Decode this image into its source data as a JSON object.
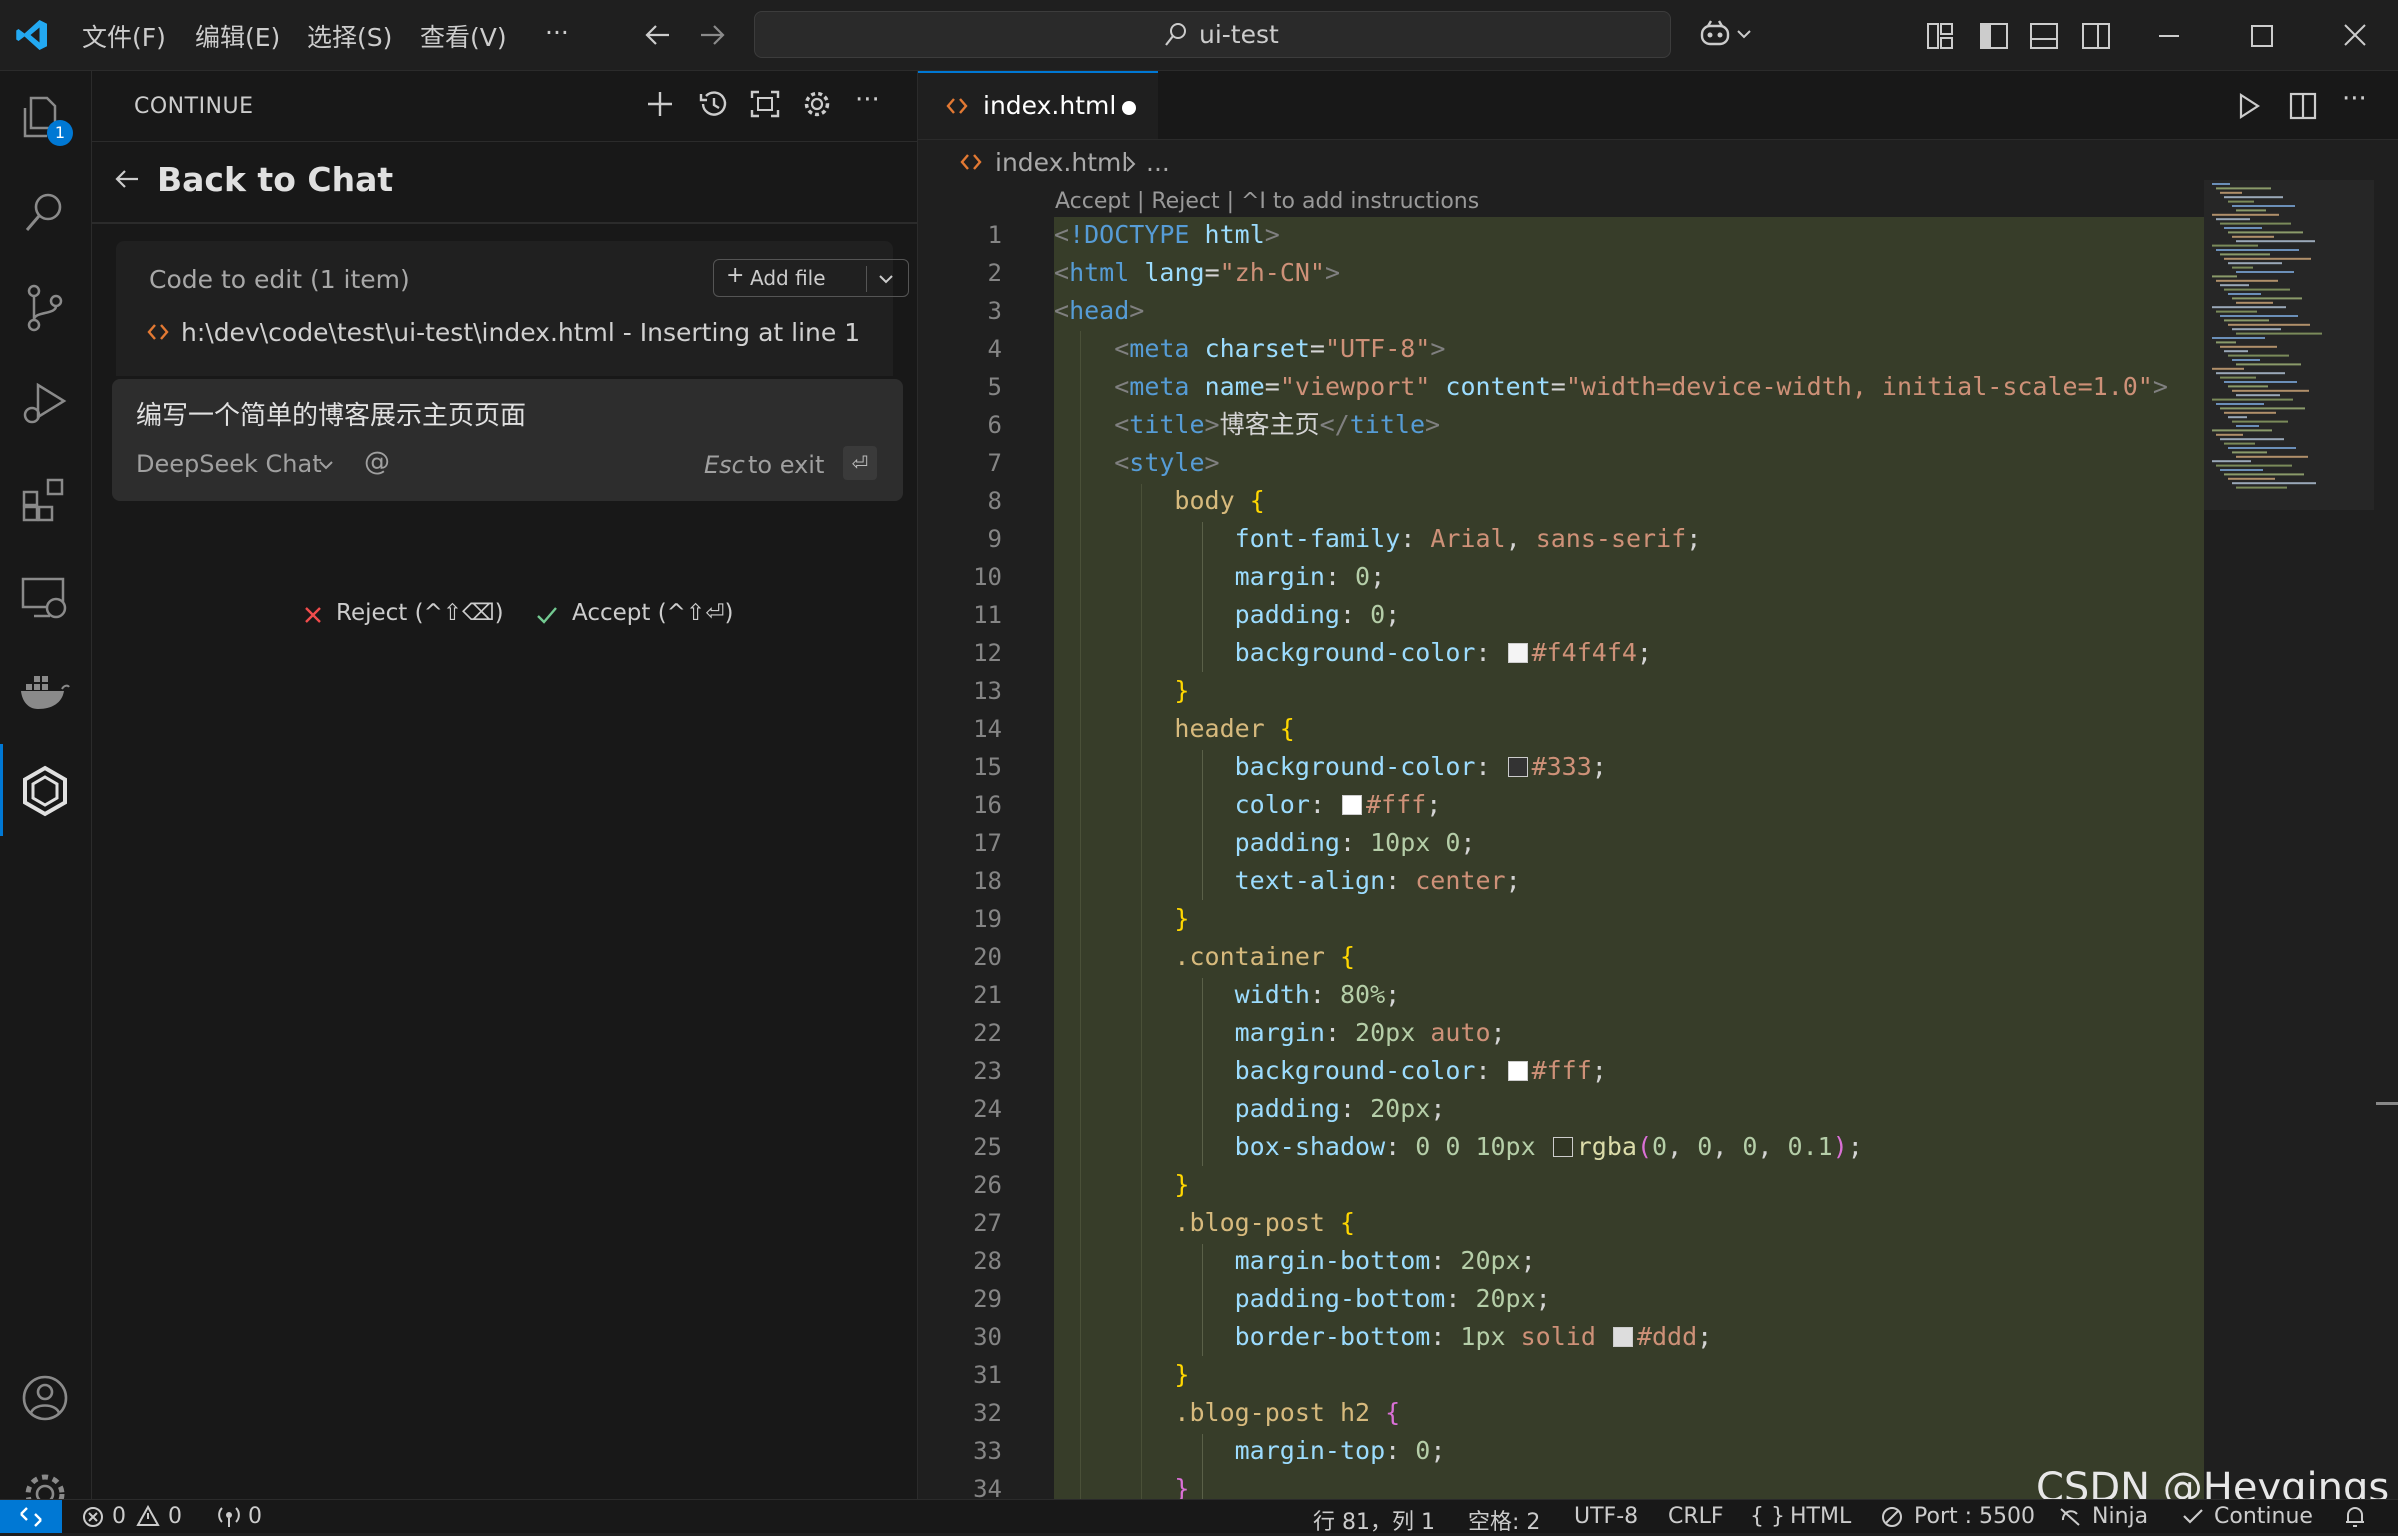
{
  "titlebar": {
    "menus": [
      "文件(F)",
      "编辑(E)",
      "选择(S)",
      "查看(V)",
      "···"
    ],
    "search_text": "ui-test"
  },
  "activity": {
    "explorer_badge": "1"
  },
  "panel": {
    "title": "CONTINUE",
    "back_label": "Back to Chat",
    "code_to_edit_label": "Code to edit (1 item)",
    "add_file_label": "Add file",
    "file_path": "h:\\dev\\code\\test\\ui-test\\index.html - Inserting at line 1",
    "prompt_text": "编写一个简单的博客展示主页页面",
    "model_label": "DeepSeek Chat",
    "at_symbol": "@",
    "esc_key": "Esc",
    "esc_text": "to exit",
    "reject_label": "Reject (^⇧⌫)",
    "accept_label": "Accept (^⇧⏎)"
  },
  "editor": {
    "tab_label": "index.html",
    "breadcrumb_file": "index.html",
    "breadcrumb_more": "...",
    "codelens": "Accept | Reject | ^I to add instructions",
    "line_numbers": [
      "1",
      "2",
      "3",
      "4",
      "5",
      "6",
      "7",
      "8",
      "9",
      "10",
      "11",
      "12",
      "13",
      "14",
      "15",
      "16",
      "17",
      "18",
      "19",
      "20",
      "21",
      "22",
      "23",
      "24",
      "25",
      "26",
      "27",
      "28",
      "29",
      "30",
      "31",
      "32",
      "33",
      "34"
    ]
  },
  "statusbar": {
    "errors": "0",
    "warnings": "0",
    "ports": "0",
    "position": "行 81，列 1",
    "spaces": "空格: 2",
    "encoding": "UTF-8",
    "eol": "CRLF",
    "language": "HTML",
    "port": "Port : 5500",
    "ninja": "Ninja",
    "continue": "Continue"
  },
  "watermark": "CSDN @Heyqings",
  "colors": {
    "accent": "#0078d4",
    "diff_bg": "#373d29",
    "badge": "#0078d4"
  }
}
